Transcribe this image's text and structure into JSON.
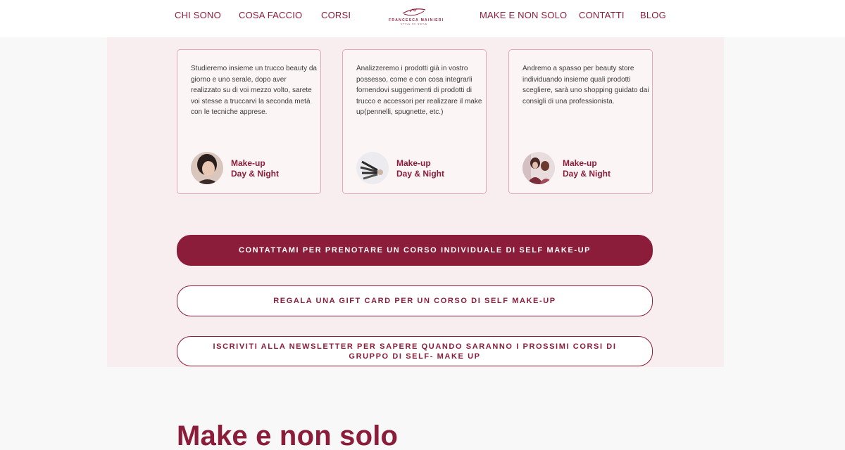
{
  "nav": {
    "left": [
      "CHI SONO",
      "COSA FACCIO",
      "CORSI"
    ],
    "right": [
      "MAKE E NON SOLO",
      "CONTATTI",
      "BLOG"
    ],
    "logo_name": "FRANCESCA MAINIERI",
    "logo_sub": "STYLE OF SMILE"
  },
  "cards": [
    {
      "text": "Studieremo insieme un trucco beauty da giorno e uno serale, dopo aver realizzato su di voi mezzo volto, sarete voi stesse a truccarvi la seconda metà con le tecniche apprese.",
      "title_line1": "Make-up",
      "title_line2": "Day & Night",
      "icon": "woman-portrait-icon"
    },
    {
      "text": "Analizzeremo i prodotti già in vostro possesso, come e con cosa integrarli fornendovi suggerimenti di prodotti di trucco e accessori per realizzare il make up(pennelli, spugnette, etc.)",
      "title_line1": "Make-up",
      "title_line2": "Day & Night",
      "icon": "makeup-brushes-icon"
    },
    {
      "text": "Andremo a spasso per beauty store individuando insieme quali prodotti scegliere, sarà uno shopping guidato dai consigli di una professionista.",
      "title_line1": "Make-up",
      "title_line2": "Day & Night",
      "icon": "shopping-photo-icon"
    }
  ],
  "buttons": {
    "contact": "CONTATTAMI PER PRENOTARE UN CORSO INDIVIDUALE DI SELF MAKE-UP",
    "gift": "REGALA UNA GIFT CARD PER UN CORSO DI SELF MAKE-UP",
    "newsletter": "ISCRIVITI ALLA NEWSLETTER PER SAPERE QUANDO SARANNO I PROSSIMI CORSI DI GRUPPO DI SELF- MAKE UP"
  },
  "section_heading": "Make e non solo",
  "colors": {
    "brand": "#8c1d3a",
    "card_border": "#e6a6b4",
    "section_bg": "#f8eeef"
  }
}
